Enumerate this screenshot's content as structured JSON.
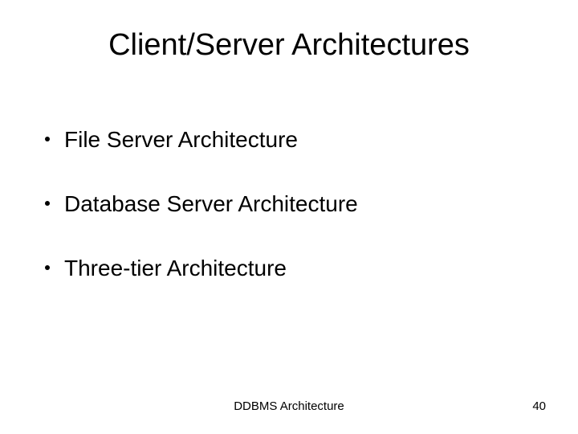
{
  "title": "Client/Server Architectures",
  "bullets": [
    "File Server Architecture",
    "Database Server Architecture",
    "Three-tier Architecture"
  ],
  "footer": "DDBMS Architecture",
  "page_number": "40"
}
